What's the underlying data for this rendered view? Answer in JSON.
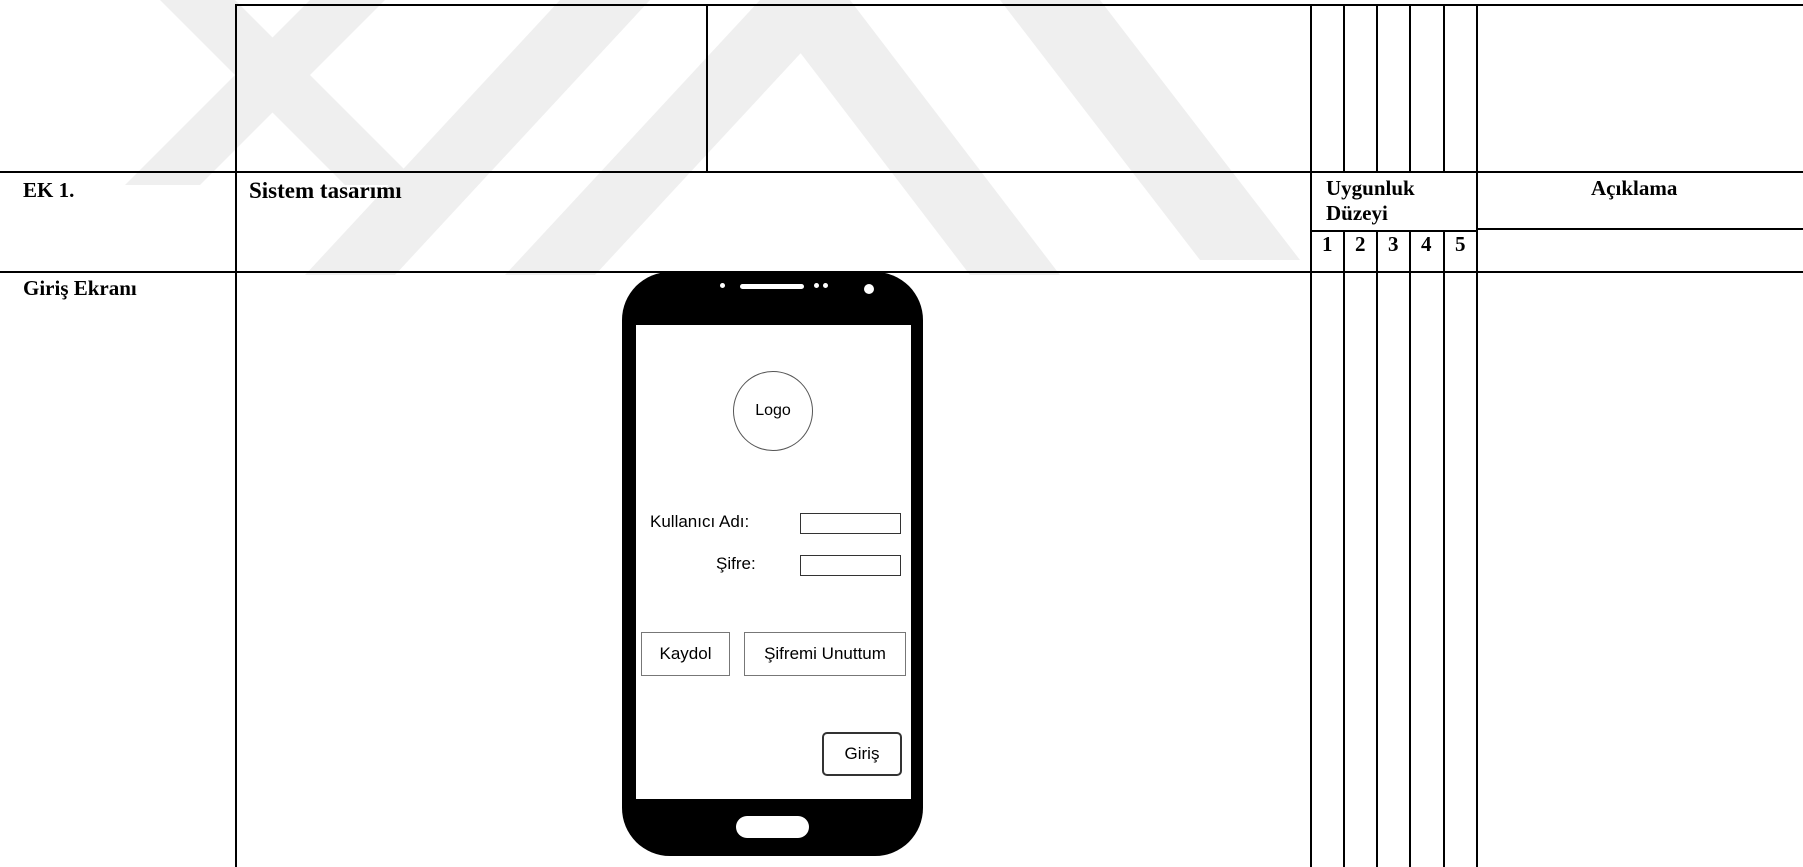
{
  "watermark": {
    "color": "#eeeeee"
  },
  "header": {
    "ek_label": "EK 1.",
    "system_title": "Sistem tasarımı",
    "uygunluk_label": "Uygunluk",
    "duzeyi_label": "Düzeyi",
    "aciklama_label": "Açıklama",
    "levels": [
      "1",
      "2",
      "3",
      "4",
      "5"
    ]
  },
  "row": {
    "label": "Giriş Ekranı"
  },
  "phone": {
    "logo_text": "Logo",
    "username_label": "Kullanıcı Adı:",
    "password_label": "Şifre:",
    "username_value": "",
    "password_value": "",
    "register_button": "Kaydol",
    "forgot_button": "Şifremi Unuttum",
    "login_button": "Giriş"
  }
}
